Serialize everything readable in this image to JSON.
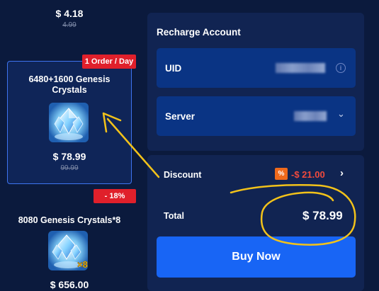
{
  "products": {
    "top": {
      "price": "$ 4.18",
      "old_price": "4.99"
    },
    "selected": {
      "title": "6480+1600 Genesis Crystals",
      "price": "$ 78.99",
      "old_price": "99.99",
      "badge": "1 Order / Day",
      "icon": "genesis-crystals-icon"
    },
    "bottom": {
      "title": "8080 Genesis Crystals*8",
      "price": "$ 656.00",
      "badge": "- 18%",
      "multiplier": "×8",
      "icon": "genesis-crystals-icon"
    }
  },
  "recharge": {
    "title": "Recharge Account",
    "uid_label": "UID",
    "server_label": "Server"
  },
  "summary": {
    "discount_label": "Discount",
    "discount_icon_text": "%",
    "discount_value": "-$ 21.00",
    "total_label": "Total",
    "total_value": "$ 78.99",
    "buy_label": "Buy Now"
  },
  "colors": {
    "background": "#0b1a3d",
    "panel": "#112452",
    "field": "#0a3484",
    "accent": "#1865f5",
    "badge": "#e0202b",
    "discount": "#f24a3c",
    "annotation": "#f2c21a"
  }
}
